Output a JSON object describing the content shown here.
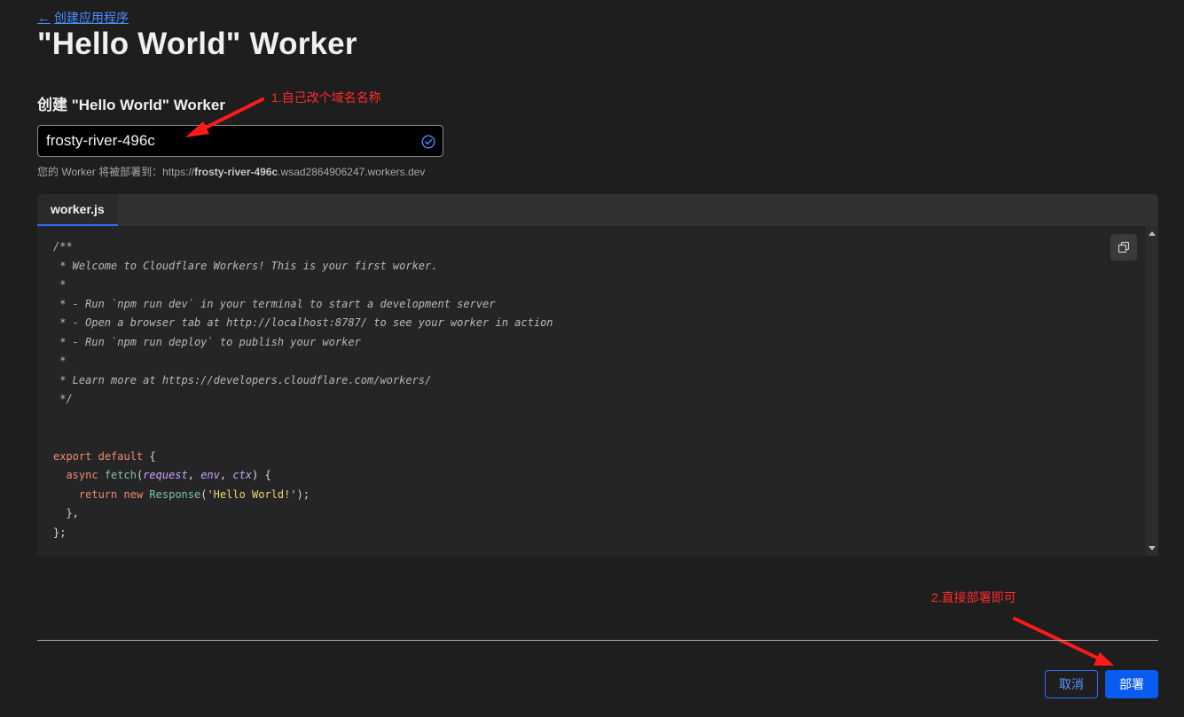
{
  "header": {
    "back_label": "创建应用程序",
    "title": "\"Hello World\" Worker"
  },
  "form": {
    "section_title": "创建 \"Hello World\" Worker",
    "name_value": "frosty-river-496c",
    "deploy_prefix": "您的 Worker 将被部署到：https://",
    "deploy_name": "frosty-river-496c",
    "deploy_suffix": ".wsad2864906247.workers.dev"
  },
  "editor": {
    "tab_label": "worker.js",
    "comment_lines": [
      "/**",
      " * Welcome to Cloudflare Workers! This is your first worker.",
      " *",
      " * - Run `npm run dev` in your terminal to start a development server",
      " * - Open a browser tab at http://localhost:8787/ to see your worker in action",
      " * - Run `npm run deploy` to publish your worker",
      " *",
      " * Learn more at https://developers.cloudflare.com/workers/",
      " */"
    ],
    "code": {
      "export": "export",
      "default": "default",
      "brace_open": " {",
      "async": "async",
      "fetch": "fetch",
      "params_open": "(",
      "request": "request",
      "env": "env",
      "ctx": "ctx",
      "params_close": ") {",
      "return": "return",
      "new": "new",
      "response": "Response",
      "string": "'Hello World!'",
      "call_end": ");",
      "inner_close": "},",
      "outer_close": "};"
    }
  },
  "actions": {
    "cancel_label": "取消",
    "deploy_label": "部署"
  },
  "annotations": {
    "note_1": "1.自己改个域名名称",
    "note_2": "2.直接部署即可"
  },
  "colors": {
    "accent": "#0a5cf0",
    "link": "#4a8cff",
    "annotation": "#ff2a2a"
  }
}
